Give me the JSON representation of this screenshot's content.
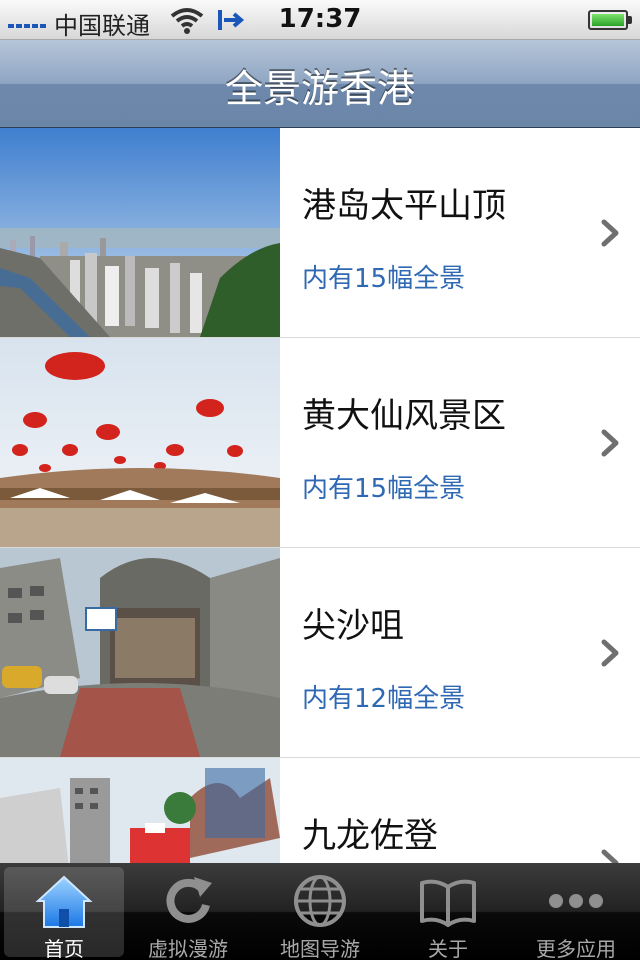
{
  "status_bar": {
    "carrier": "中国联通",
    "time": "17:37"
  },
  "nav": {
    "title": "全景游香港"
  },
  "list": {
    "items": [
      {
        "title": "港岛太平山顶",
        "subtitle": "内有15幅全景"
      },
      {
        "title": "黄大仙风景区",
        "subtitle": "内有15幅全景"
      },
      {
        "title": "尖沙咀",
        "subtitle": "内有12幅全景"
      },
      {
        "title": "九龙佐登",
        "subtitle": ""
      }
    ]
  },
  "tabs": [
    {
      "label": "首页",
      "icon": "home-icon",
      "active": true
    },
    {
      "label": "虚拟漫游",
      "icon": "refresh-icon",
      "active": false
    },
    {
      "label": "地图导游",
      "icon": "globe-icon",
      "active": false
    },
    {
      "label": "关于",
      "icon": "book-icon",
      "active": false
    },
    {
      "label": "更多应用",
      "icon": "more-icon",
      "active": false
    }
  ],
  "colors": {
    "accent": "#2f69b3",
    "nav": "#6d88ab",
    "tabbar": "#000000"
  }
}
